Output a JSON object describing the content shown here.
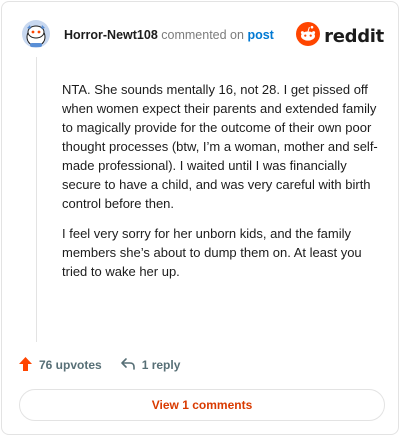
{
  "comment": {
    "username": "Horror-Newt108",
    "action_text": "commented on",
    "post_link": "post",
    "paragraphs": [
      "NTA. She sounds mentally 16, not 28. I get pissed off when women expect their parents and extended family to magically provide for the outcome of their own poor thought processes (btw, I’m a woman, mother and self-made professional). I waited until I was financially secure to have a child, and was very careful with birth control before then.",
      "I feel very sorry for her unborn kids, and the family members she’s about to dump them on. At least you tried to wake her up."
    ],
    "upvotes": "76 upvotes",
    "replies": "1 reply",
    "view_comments": "View 1 comments"
  },
  "brand": {
    "wordmark": "reddit",
    "accent_color": "#ff4500"
  },
  "icons": {
    "avatar": "snoo-avatar-icon",
    "logo": "reddit-logo-icon",
    "upvote": "upvote-arrow-icon",
    "reply": "reply-arrow-icon"
  },
  "colors": {
    "upvote": "#ff4500",
    "link": "#0079d3",
    "view_button_text": "#d93a00"
  }
}
